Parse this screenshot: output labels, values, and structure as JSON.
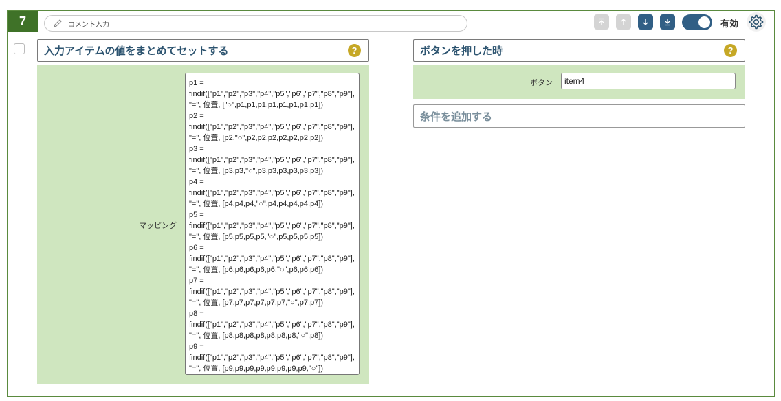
{
  "item": {
    "number": "7",
    "comment_placeholder": "コメント入力",
    "enabled_label": "有効"
  },
  "left_section": {
    "title": "入力アイテムの値をまとめてセットする",
    "mapping_label": "マッピング",
    "mapping_value": "p1 =\nfindif([\"p1\",\"p2\",\"p3\",\"p4\",\"p5\",\"p6\",\"p7\",\"p8\",\"p9\"],\n\"=\", 位置, [\"○\",p1,p1,p1,p1,p1,p1,p1,p1])\np2 =\nfindif([\"p1\",\"p2\",\"p3\",\"p4\",\"p5\",\"p6\",\"p7\",\"p8\",\"p9\"],\n\"=\", 位置, [p2,\"○\",p2,p2,p2,p2,p2,p2,p2])\np3 =\nfindif([\"p1\",\"p2\",\"p3\",\"p4\",\"p5\",\"p6\",\"p7\",\"p8\",\"p9\"],\n\"=\", 位置, [p3,p3,\"○\",p3,p3,p3,p3,p3,p3])\np4 =\nfindif([\"p1\",\"p2\",\"p3\",\"p4\",\"p5\",\"p6\",\"p7\",\"p8\",\"p9\"],\n\"=\", 位置, [p4,p4,p4,\"○\",p4,p4,p4,p4,p4])\np5 =\nfindif([\"p1\",\"p2\",\"p3\",\"p4\",\"p5\",\"p6\",\"p7\",\"p8\",\"p9\"],\n\"=\", 位置, [p5,p5,p5,p5,\"○\",p5,p5,p5,p5])\np6 =\nfindif([\"p1\",\"p2\",\"p3\",\"p4\",\"p5\",\"p6\",\"p7\",\"p8\",\"p9\"],\n\"=\", 位置, [p6,p6,p6,p6,p6,\"○\",p6,p6,p6])\np7 =\nfindif([\"p1\",\"p2\",\"p3\",\"p4\",\"p5\",\"p6\",\"p7\",\"p8\",\"p9\"],\n\"=\", 位置, [p7,p7,p7,p7,p7,p7,\"○\",p7,p7])\np8 =\nfindif([\"p1\",\"p2\",\"p3\",\"p4\",\"p5\",\"p6\",\"p7\",\"p8\",\"p9\"],\n\"=\", 位置, [p8,p8,p8,p8,p8,p8,p8,\"○\",p8])\np9 =\nfindif([\"p1\",\"p2\",\"p3\",\"p4\",\"p5\",\"p6\",\"p7\",\"p8\",\"p9\"],\n\"=\", 位置, [p9,p9,p9,p9,p9,p9,p9,p9,\"○\"])"
  },
  "right_section": {
    "title": "ボタンを押した時",
    "button_label": "ボタン",
    "button_value": "item4",
    "add_condition_label": "条件を追加する"
  },
  "help_glyph": "?",
  "icons": [
    "pencil-icon",
    "move-top-icon",
    "move-up-icon",
    "move-down-icon",
    "move-bottom-icon",
    "gear-icon",
    "help-icon"
  ],
  "colors": {
    "badge": "#3f7228",
    "accent": "#315f85",
    "panel_green": "#cfe6bf",
    "help": "#c6a826",
    "title_text": "#2d5470"
  }
}
